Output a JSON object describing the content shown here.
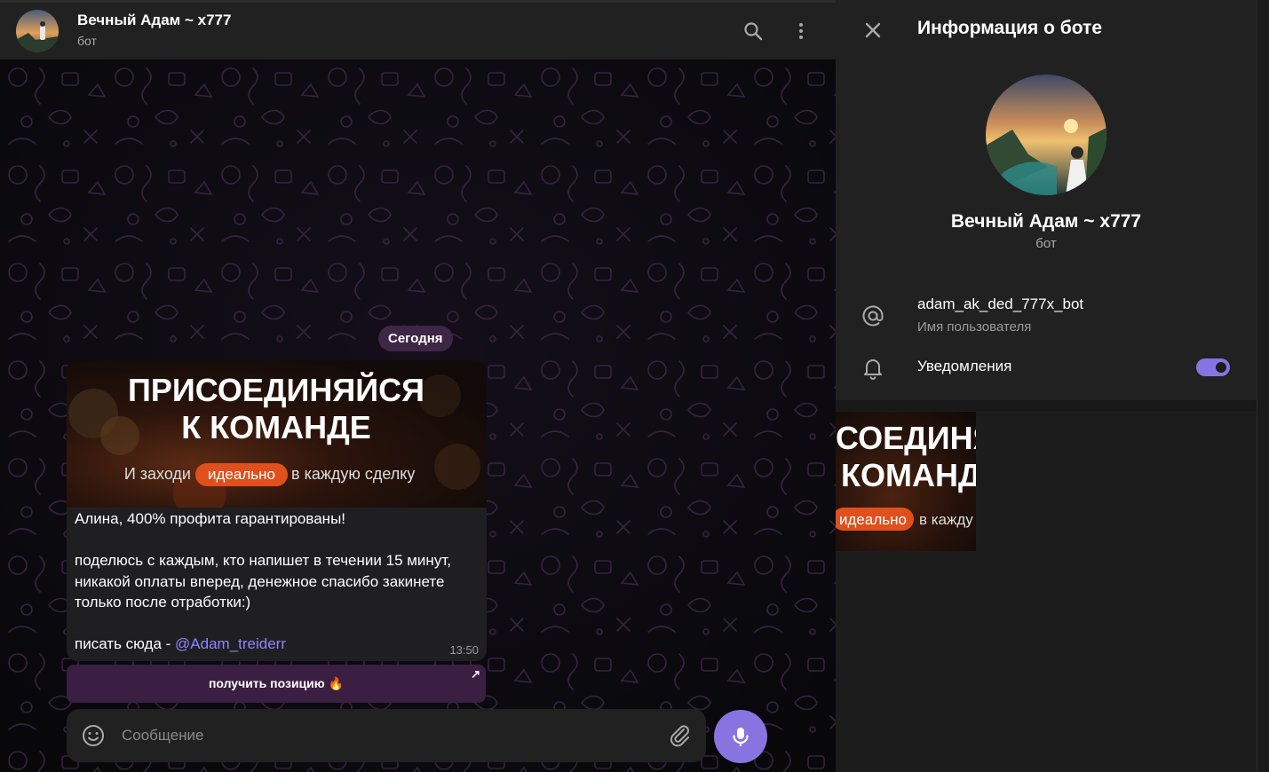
{
  "chat": {
    "title": "Вечный Адам ~ x777",
    "subtitle": "бот",
    "date_label": "Сегодня",
    "message": {
      "banner_line1": "ПРИСОЕДИНЯЙСЯ",
      "banner_line2": "К КОМАНДЕ",
      "banner_pre": "И заходи",
      "banner_highlight": "идеально",
      "banner_post": "в каждую сделку",
      "line1": "Алина, 400% профита гарантированы!",
      "line2": "поделюсь с каждым, кто напишет в течении 15 минут, никакой оплаты вперед, денежное спасибо закинете только после отработки:)",
      "line3_prefix": "писать сюда - ",
      "line3_mention": "@Adam_treiderr",
      "time": "13:50"
    },
    "inline_button_label": "получить позицию 🔥",
    "inline_button_corner": "↗",
    "composer_placeholder": "Сообщение"
  },
  "panel": {
    "title": "Информация о боте",
    "bot_name": "Вечный Адам ~ x777",
    "bot_sub": "бот",
    "username": "adam_ak_ded_777x_bot",
    "username_label": "Имя пользователя",
    "notifications_label": "Уведомления",
    "notifications_on": true,
    "media": {
      "line1": "СОЕДИНЯЙ",
      "line2": "КОМАНД",
      "highlight": "идеально",
      "post": "в кажду"
    }
  },
  "colors": {
    "accent": "#8774e1",
    "highlight_pill": "#e0501c",
    "mention": "#8f85ff",
    "header_bg": "#212121"
  },
  "icons": [
    "search-icon",
    "more-vertical-icon",
    "close-icon",
    "at-icon",
    "bell-icon",
    "emoji-icon",
    "attach-icon",
    "mic-icon",
    "external-link-icon"
  ]
}
